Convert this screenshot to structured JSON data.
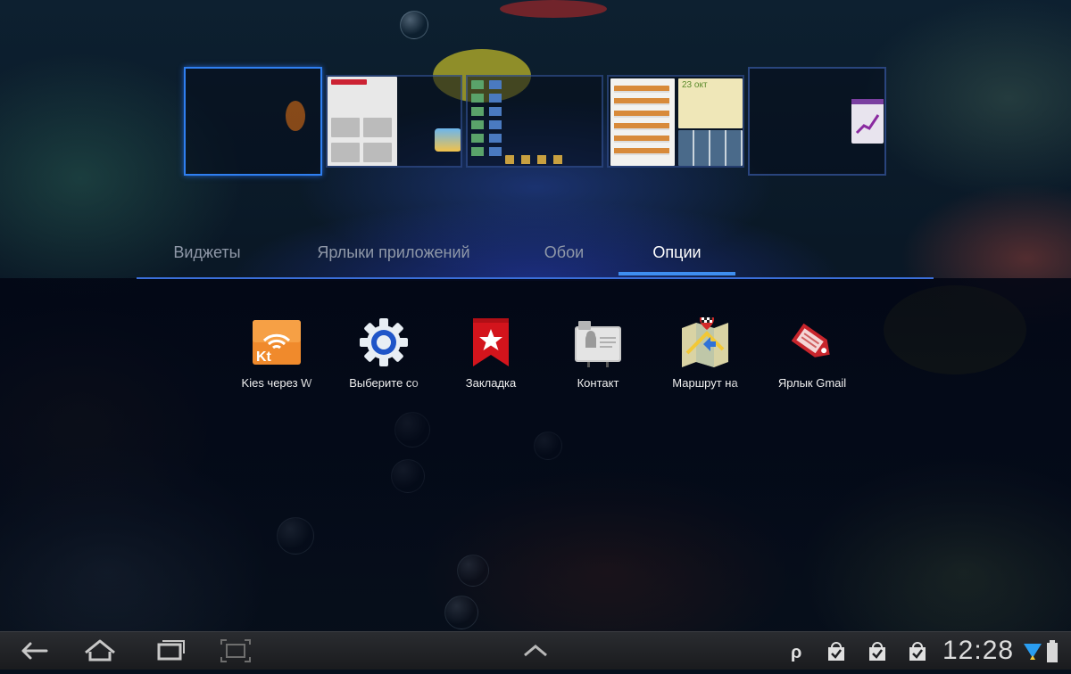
{
  "tabs": [
    {
      "label": "Виджеты",
      "active": false
    },
    {
      "label": "Ярлыки приложений",
      "active": false
    },
    {
      "label": "Обои",
      "active": false
    },
    {
      "label": "Опции",
      "active": true
    }
  ],
  "shortcuts": [
    {
      "label": "Kies через W",
      "icon": "kies-wifi-icon"
    },
    {
      "label": "Выберите со",
      "icon": "settings-gear-icon"
    },
    {
      "label": "Закладка",
      "icon": "bookmark-icon"
    },
    {
      "label": "Контакт",
      "icon": "contact-icon"
    },
    {
      "label": "Маршрут на",
      "icon": "maps-directions-icon"
    },
    {
      "label": "Ярлык Gmail",
      "icon": "gmail-label-icon"
    }
  ],
  "home_pages": [
    {
      "name": "page-1",
      "current": true
    },
    {
      "name": "page-2",
      "current": false
    },
    {
      "name": "page-3",
      "current": false
    },
    {
      "name": "page-4",
      "current": false
    },
    {
      "name": "page-5",
      "current": false
    }
  ],
  "page4": {
    "date_text": "23 окт"
  },
  "statusbar": {
    "time": "12:28"
  },
  "colors": {
    "accent": "#3e8ef0",
    "tab_inactive": "#8f98a8",
    "tab_active": "#ffffff"
  }
}
